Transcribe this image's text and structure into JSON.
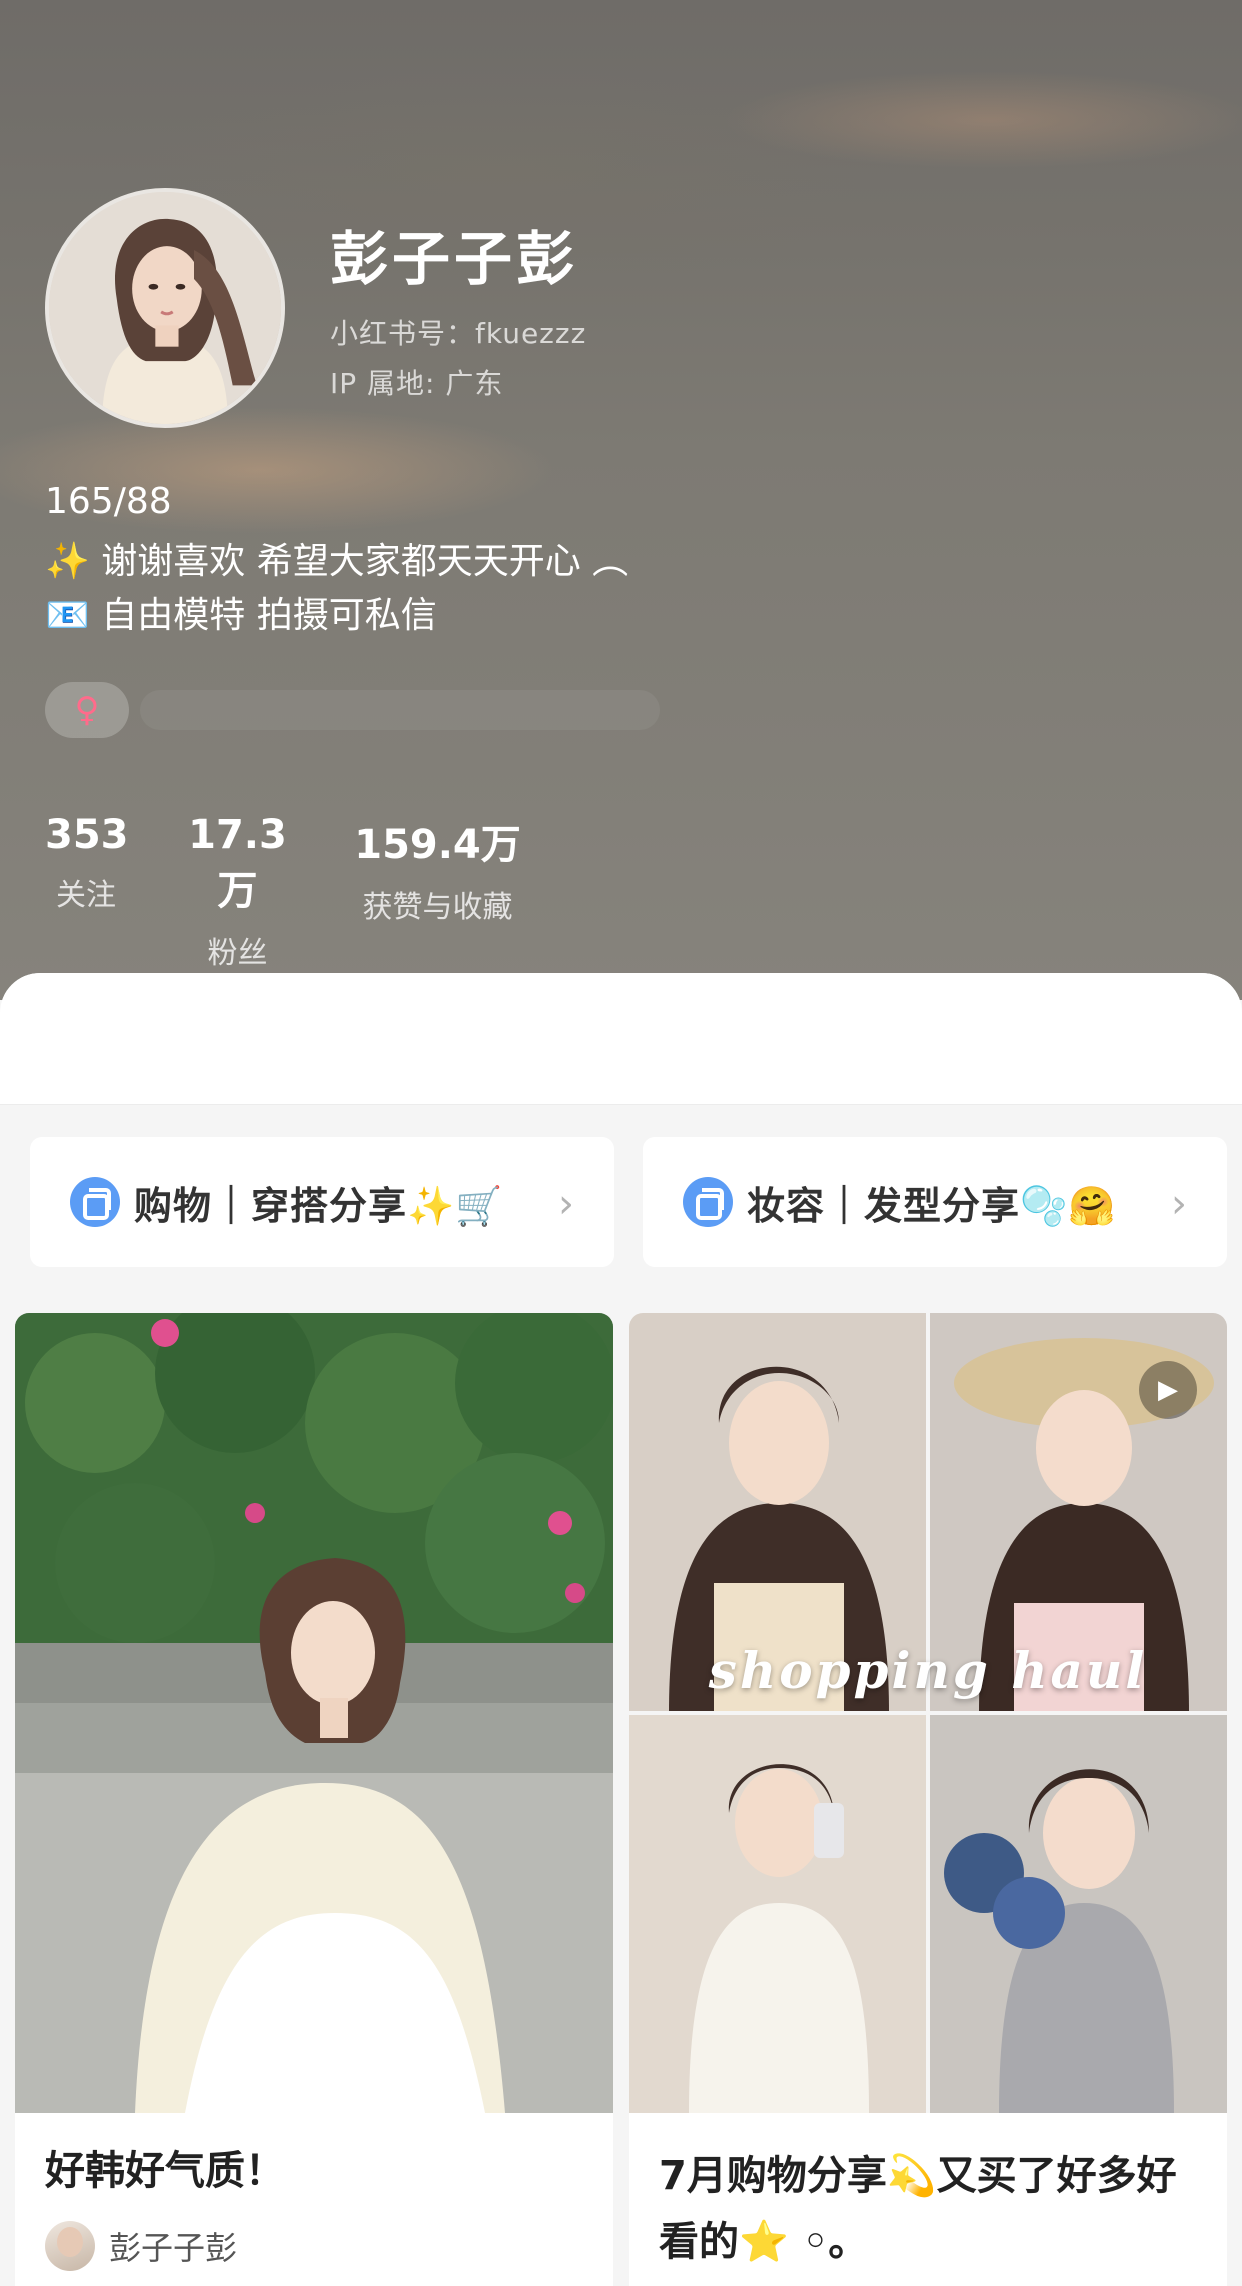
{
  "profile": {
    "username": "彭子子彭",
    "id_line": "小红书号：fkuezzz",
    "ip_line": "IP 属地: 广东",
    "bio": [
      "165/88",
      "✨ 谢谢喜欢 希望大家都天天开心 ︵",
      "📧 自由模特 拍摄可私信"
    ],
    "gender_symbol": "♀",
    "gender_color": "#ff6b8b"
  },
  "stats": {
    "following": {
      "value": "353",
      "label": "关注"
    },
    "fans": {
      "value": "17.3万",
      "label": "粉丝"
    },
    "likes": {
      "value": "159.4万",
      "label": "获赞与收藏"
    }
  },
  "collections": [
    {
      "label": "购物｜穿搭分享✨🛒",
      "icon": "collection-icon",
      "arrow": "›"
    },
    {
      "label": "妆容｜发型分享🫧🤗",
      "icon": "collection-icon",
      "arrow": "›"
    }
  ],
  "notes": [
    {
      "title": "好韩好气质！",
      "author": "彭子子彭",
      "cover": "photo-woman-flowers"
    },
    {
      "title": "7月购物分享💫又买了好多好看的⭐ ◦。",
      "cover_text": "shopping haul",
      "type_icon": "play-icon",
      "play_glyph": "▶",
      "cover": "photo-collage"
    }
  ],
  "colors": {
    "accent_blue": "#5b9cf5",
    "header_bg": "#7d7a73"
  }
}
